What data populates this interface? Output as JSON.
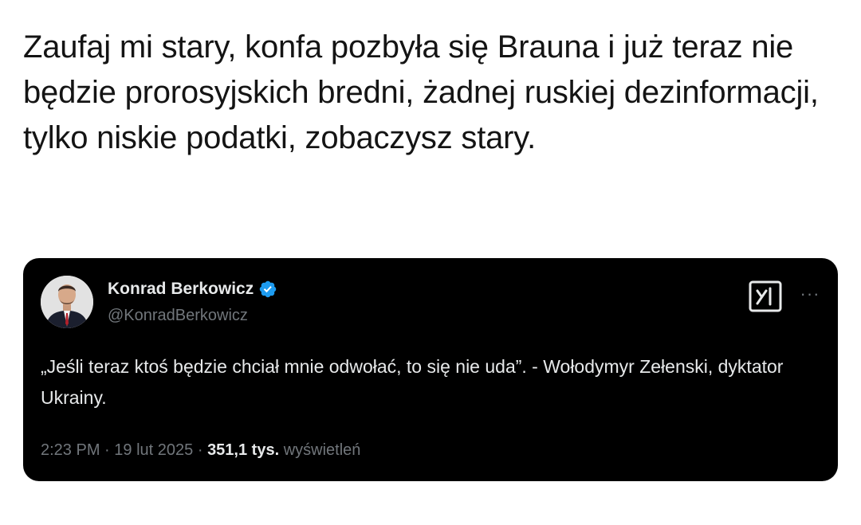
{
  "caption": {
    "text": "Zaufaj mi stary, konfa pozbyła się Brauna i już teraz nie będzie prorosyjskich bredni, żadnej ruskiej dezinformacji, tylko niskie podatki, zobaczysz stary."
  },
  "tweet": {
    "author": {
      "display_name": "Konrad Berkowicz",
      "handle": "@KonradBerkowicz",
      "verified": true
    },
    "text": "„Jeśli teraz ktoś będzie chciał mnie odwołać, to się nie uda”. - Wołodymyr Zełenski, dyktator Ukrainy.",
    "time": "2:23 PM",
    "separator": "·",
    "date": "19 lut 2025",
    "views_count": "351,1 tys.",
    "views_label": "wyświetleń",
    "more_label": "···",
    "icons": {
      "verified": "verified-badge-icon",
      "grok": "grok-icon",
      "more": "more-options-icon"
    },
    "colors": {
      "card_background": "#000000",
      "primary_text": "#e7e9ea",
      "secondary_text": "#71767b",
      "verified_blue": "#1d9bf0"
    }
  }
}
